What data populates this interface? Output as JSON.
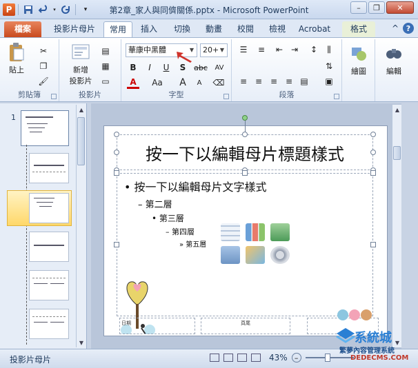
{
  "window": {
    "title": "第2章_家人與同儕關係.pptx - Microsoft PowerPoint",
    "app_icon_letter": "P"
  },
  "tabs": {
    "file": "檔案",
    "items": [
      "投影片母片",
      "常用",
      "插入",
      "切換",
      "動畫",
      "校閱",
      "檢視",
      "Acrobat",
      "格式"
    ],
    "active": "常用"
  },
  "ribbon": {
    "clipboard": {
      "paste": "貼上",
      "label": "剪貼簿"
    },
    "slides": {
      "new_slide_line1": "新增",
      "new_slide_line2": "投影片",
      "label": "投影片"
    },
    "font": {
      "font_name": "華康中黑體",
      "font_size": "20+",
      "bold": "B",
      "italic": "I",
      "underline": "U",
      "shadow": "S",
      "strike": "abc",
      "spacing": "AV",
      "font_color": "A",
      "change_case": "Aa",
      "grow": "A",
      "shrink": "A",
      "label": "字型"
    },
    "paragraph": {
      "label": "段落"
    },
    "drawing": {
      "label": "繪圖"
    },
    "editing": {
      "label": "編輯"
    }
  },
  "thumbnails": {
    "first_number": "1"
  },
  "slide": {
    "title": "按一下以編輯母片標題樣式",
    "body": {
      "level1": "按一下以編輯母片文字樣式",
      "level2": "第二層",
      "level3": "第三層",
      "level4": "第四層",
      "level5": "第五層"
    },
    "footer_date": "日期",
    "footer_center": "頁尾"
  },
  "statusbar": {
    "mode": "投影片母片",
    "zoom": "43%"
  },
  "watermark": {
    "line1": "系統城",
    "line2": "繁夢內容管理系統",
    "line3": "DEDECMS.COM"
  },
  "colors": {
    "accent_file_tab": "#c94a1e",
    "arrow_red": "#d0342c"
  }
}
